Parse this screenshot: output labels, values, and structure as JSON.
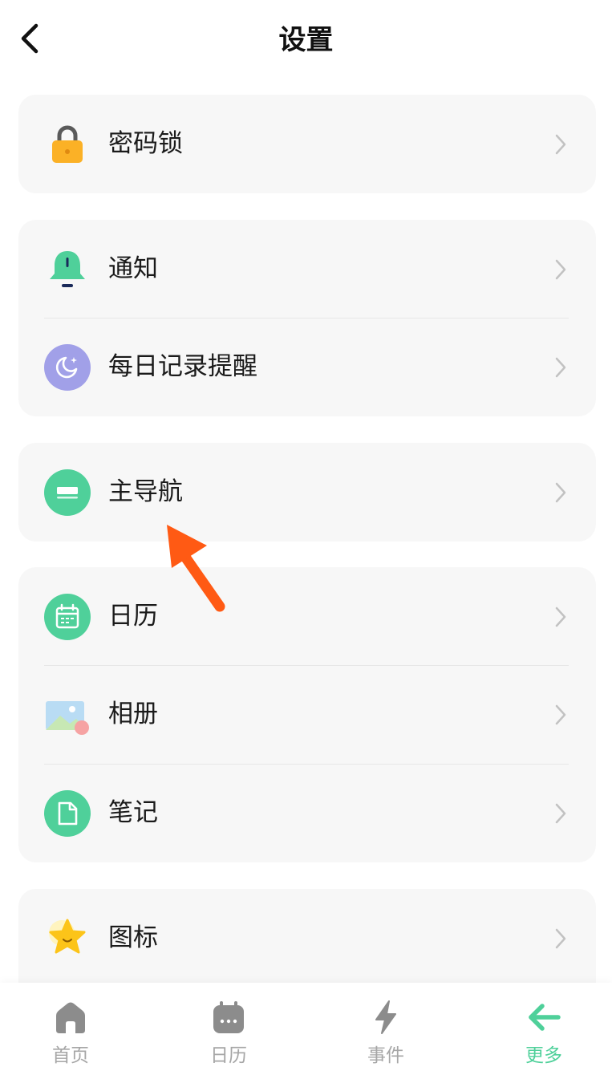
{
  "header": {
    "title": "设置",
    "back_icon": "chevron-left-icon"
  },
  "groups": [
    {
      "items": [
        {
          "label": "密码锁",
          "icon": "lock-icon"
        }
      ]
    },
    {
      "items": [
        {
          "label": "通知",
          "icon": "bell-icon"
        },
        {
          "label": "每日记录提醒",
          "icon": "moon-icon"
        }
      ]
    },
    {
      "items": [
        {
          "label": "主导航",
          "icon": "navigation-bar-icon"
        }
      ]
    },
    {
      "items": [
        {
          "label": "日历",
          "icon": "calendar-icon"
        },
        {
          "label": "相册",
          "icon": "photo-album-icon"
        },
        {
          "label": "笔记",
          "icon": "note-icon"
        }
      ]
    },
    {
      "items": [
        {
          "label": "图标",
          "icon": "star-icon"
        }
      ]
    }
  ],
  "bottom_nav": {
    "items": [
      {
        "label": "首页",
        "icon": "home-icon",
        "active": false
      },
      {
        "label": "日历",
        "icon": "calendar-icon",
        "active": false
      },
      {
        "label": "事件",
        "icon": "lightning-icon",
        "active": false
      },
      {
        "label": "更多",
        "icon": "arrow-left-icon",
        "active": true
      }
    ]
  },
  "colors": {
    "card_background": "#f7f7f7",
    "accent_green": "#4fd09a",
    "lock_orange": "#fbb126",
    "moon_purple": "#a1a0e8",
    "annotation_arrow": "#ff5a14",
    "inactive_nav": "#a6a6a6"
  }
}
